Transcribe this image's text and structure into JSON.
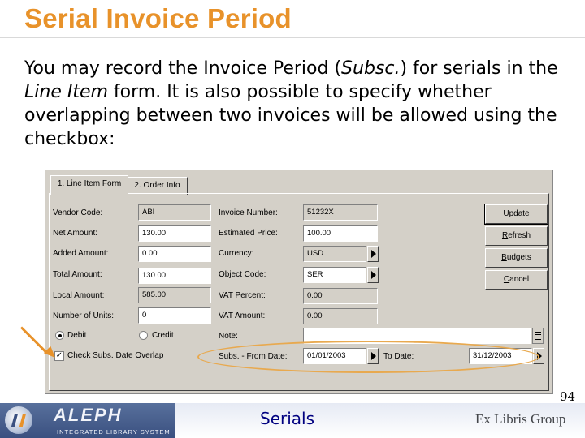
{
  "slide": {
    "title": "Serial Invoice Period",
    "intro": {
      "part1": "You may record the Invoice Period (",
      "term1": "Subsc.",
      "part2": ") for serials in the ",
      "term2": "Line Item",
      "part3": " form. It is also possible to specify whether overlapping between two invoices will be allowed using the checkbox:"
    },
    "page_number": "94"
  },
  "dialog": {
    "tabs": [
      {
        "label": "1. Line Item Form",
        "active": true
      },
      {
        "label": "2. Order Info",
        "active": false
      }
    ],
    "fields": {
      "vendor_code": {
        "label": "Vendor Code:",
        "value": "ABI"
      },
      "net_amount": {
        "label": "Net Amount:",
        "value": "130.00"
      },
      "added_amount": {
        "label": "Added Amount:",
        "value": "0.00"
      },
      "total_amount": {
        "label": "Total Amount:",
        "value": "130.00"
      },
      "local_amount": {
        "label": "Local Amount:",
        "value": "585.00"
      },
      "number_of_units": {
        "label": "Number of Units:",
        "value": "0"
      },
      "invoice_number": {
        "label": "Invoice Number:",
        "value": "51232X"
      },
      "estimated_price": {
        "label": "Estimated Price:",
        "value": "100.00"
      },
      "currency": {
        "label": "Currency:",
        "value": "USD"
      },
      "object_code": {
        "label": "Object Code:",
        "value": "SER"
      },
      "vat_percent": {
        "label": "VAT Percent:",
        "value": "0.00"
      },
      "vat_amount": {
        "label": "VAT Amount:",
        "value": "0.00"
      },
      "note": {
        "label": "Note:",
        "value": ""
      },
      "subs_from_date": {
        "label": "Subs. - From Date:",
        "value": "01/01/2003"
      },
      "to_date": {
        "label": "To Date:",
        "value": "31/12/2003"
      }
    },
    "radios": {
      "debit": {
        "label": "Debit",
        "selected": true
      },
      "credit": {
        "label": "Credit",
        "selected": false
      }
    },
    "checkbox": {
      "label": "Check Subs. Date Overlap",
      "checked": true,
      "mark": "✓"
    },
    "buttons": {
      "update": {
        "pre": "",
        "ul": "U",
        "post": "pdate"
      },
      "refresh": {
        "pre": "",
        "ul": "R",
        "post": "efresh"
      },
      "budgets": {
        "pre": "",
        "ul": "B",
        "post": "udgets"
      },
      "cancel": {
        "pre": "",
        "ul": "C",
        "post": "ancel"
      }
    }
  },
  "footer": {
    "logo_word": "ALEPH",
    "logo_sub": "INTEGRATED LIBRARY SYSTEM",
    "center_text": "Serials",
    "partner_logo": "Ex Libris Group"
  },
  "colors": {
    "accent_orange": "#e8922a",
    "dialog_gray": "#d4d0c8",
    "footer_blue": "#3a5080"
  }
}
